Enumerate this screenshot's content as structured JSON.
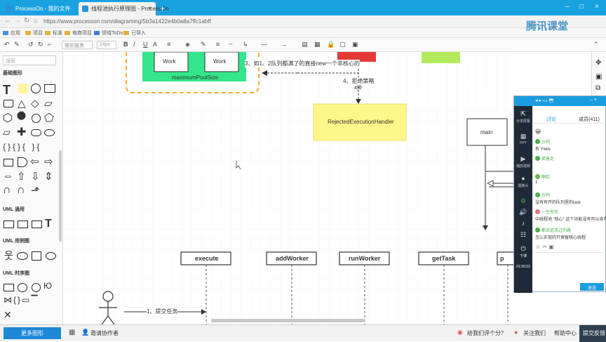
{
  "browser": {
    "tabs": [
      {
        "label": "ProcessOn - 我的文件",
        "active": false
      },
      {
        "label": "线程池执行原理图 - ProcessOn",
        "active": true
      }
    ],
    "new_tab": "+",
    "url": "https://www.processon.com/diagraming/5b3a1422e4b0a8a7ffc1abff",
    "bookmarks": [
      "应用",
      "项目",
      "标准",
      "电商项目",
      "领域ToDo",
      "已导入"
    ],
    "watermark": "腾讯课堂"
  },
  "toolbar": {
    "font": "微软雅黑",
    "size": "14px",
    "bold": "B",
    "italic": "I",
    "underline": "U",
    "fontcolor": "A"
  },
  "palette": {
    "search_placeholder": "搜索",
    "sections": [
      "基础图形",
      "UML 通用",
      "UML 用例图",
      "UML 时序图"
    ],
    "more_button": "更多图形"
  },
  "canvas": {
    "pool_label": "maximumPoolSize",
    "work_labels": [
      "Work",
      "Work"
    ],
    "step3": "3、如1、2队列都满了的直接new一个非核心的",
    "step4": "4、拒绝策略",
    "step4b": "4种",
    "rejected": "RejectedExecutionHandler",
    "main": "main",
    "methods": [
      "execute",
      "addWorker",
      "runWorker",
      "getTask",
      "p"
    ],
    "step1": "1、提交任务"
  },
  "bottom": {
    "invite": "邀请协作者",
    "rate": "给我们评个分？",
    "follow": "关注我们",
    "help": "帮助中心",
    "feedback": "提交反馈"
  },
  "chat": {
    "tabs": [
      "讨论",
      "成员(411)"
    ],
    "side": [
      "分享屏幕",
      "PPT",
      "播放视频",
      "摄像头",
      "下课"
    ],
    "time": "01:50:23",
    "messages": [
      {
        "name": "沙帅",
        "text": "有 Ywile"
      },
      {
        "name": "笑着走",
        "text": ""
      },
      {
        "name": "啊哈",
        "text": "1"
      },
      {
        "name": "沙帅",
        "text": "没有有开的队列里的task"
      },
      {
        "name": "一生有你",
        "text": "中线程池 “核心” 这个功能没有可以去判断"
      },
      {
        "name": "都说追求过的路",
        "text": "怎么实现的只保留核心线程"
      }
    ],
    "send": "发送"
  }
}
